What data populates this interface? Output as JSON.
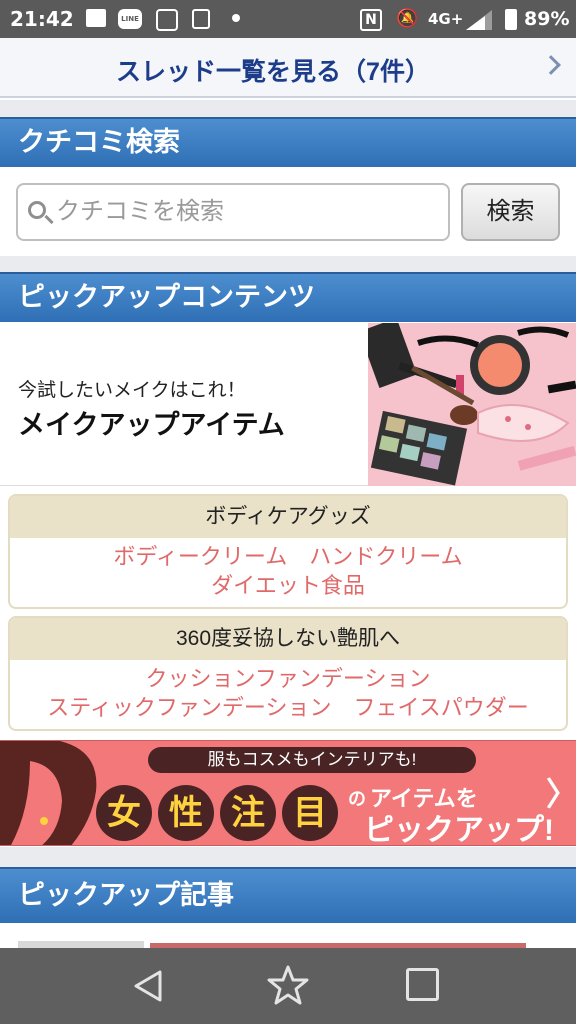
{
  "status_bar": {
    "time": "21:42",
    "network": "4G+",
    "battery": "89%",
    "icons": [
      "photo-icon",
      "line-app-icon",
      "app-icon",
      "card-icon",
      "dot-icon",
      "nfc-icon",
      "mute-bell-icon",
      "signal-icon",
      "battery-icon"
    ],
    "line_icon_text": "LINE",
    "nfc_icon_text": "N",
    "bell_icon_text": "🔕"
  },
  "thread_bar": {
    "label": "スレッド一覧を見る（7件）",
    "icon": "chevron-right-icon"
  },
  "review_search": {
    "header": "クチコミ検索",
    "placeholder": "クチコミを検索",
    "button_label": "検索"
  },
  "pickup_contents": {
    "header": "ピックアップコンテンツ",
    "banner": {
      "subtitle": "今試したいメイクはこれ！",
      "title": "メイクアップアイテム"
    },
    "categories": [
      {
        "title": "ボディケアグッズ",
        "lines": [
          [
            "ボディークリーム",
            "ハンドクリーム"
          ],
          [
            "ダイエット食品"
          ]
        ]
      },
      {
        "title": "360度妥協しない艶肌へ",
        "lines": [
          [
            "クッションファンデーション"
          ],
          [
            "スティックファンデーション",
            "フェイスパウダー"
          ]
        ]
      }
    ]
  },
  "ad_banner": {
    "top_text": "服もコスメもインテリアも!",
    "chars": [
      "女",
      "性",
      "注",
      "目"
    ],
    "no": "の",
    "item_text": "アイテムを",
    "pickup_text": "ピックアップ!",
    "chevron": "〉"
  },
  "pickup_articles": {
    "header": "ピックアップ記事"
  },
  "nav_bar": {
    "buttons": [
      "back-icon",
      "star-icon",
      "square-icon"
    ]
  },
  "colors": {
    "section_header": "#3a7cc2",
    "link_red": "#e06a6a",
    "category_head_bg": "#e9e1c8",
    "ad_bg": "#f2787a",
    "thread_text": "#1d3c8a"
  }
}
